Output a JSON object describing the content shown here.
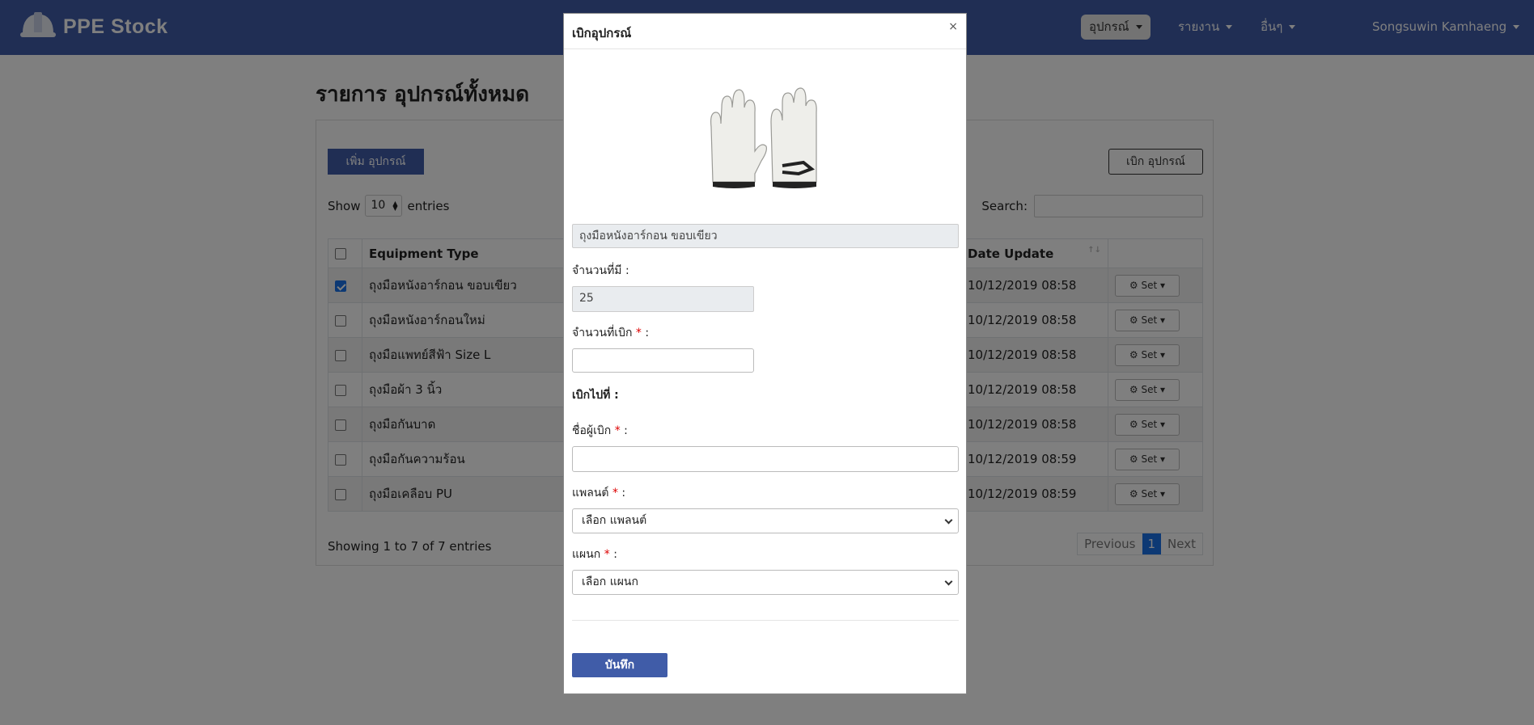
{
  "navbar": {
    "brand": "PPE Stock",
    "menu": [
      {
        "label": "อุปกรณ์",
        "active": true
      },
      {
        "label": "รายงาน",
        "active": false
      },
      {
        "label": "อื่นๆ",
        "active": false
      }
    ],
    "user": "Songsuwin Kamhaeng"
  },
  "page": {
    "title": "รายการ อุปกรณ์ทั้งหมด",
    "add_button": "เพิ่ม อุปกรณ์",
    "withdraw_button": "เบิก อุปกรณ์",
    "show_label": "Show",
    "page_length": "10",
    "entries_label": "entries",
    "search_label": "Search:",
    "table": {
      "columns": [
        "Equipment Type",
        "Date Update"
      ],
      "rows": [
        {
          "checked": true,
          "type": "ถุงมือหนังอาร์กอน ขอบเขียว",
          "date": "10/12/2019 08:58",
          "action": "Set"
        },
        {
          "checked": false,
          "type": "ถุงมือหนังอาร์กอนใหม่",
          "date": "10/12/2019 08:58",
          "action": "Set"
        },
        {
          "checked": false,
          "type": "ถุงมือแพทย์สีฟ้า Size L",
          "date": "10/12/2019 08:58",
          "action": "Set"
        },
        {
          "checked": false,
          "type": "ถุงมือผ้า 3 นิ้ว",
          "date": "10/12/2019 08:58",
          "action": "Set"
        },
        {
          "checked": false,
          "type": "ถุงมือกันบาด",
          "date": "10/12/2019 08:58",
          "action": "Set"
        },
        {
          "checked": false,
          "type": "ถุงมือกันความร้อน",
          "date": "10/12/2019 08:59",
          "action": "Set"
        },
        {
          "checked": false,
          "type": "ถุงมือเคลือบ PU",
          "date": "10/12/2019 08:59",
          "action": "Set"
        }
      ]
    },
    "info": "Showing 1 to 7 of 7 entries",
    "pager": {
      "previous": "Previous",
      "current": "1",
      "next": "Next"
    }
  },
  "modal": {
    "title": "เบิกอุปกรณ์",
    "close": "×",
    "item_name": "ถุงมือหนังอาร์กอน ขอบเขียว",
    "qty_available_label": "จำนวนที่มี :",
    "qty_available": "25",
    "qty_withdraw_label": "จำนวนที่เบิก",
    "withdraw_to_label": "เบิกไปที่ :",
    "requester_label": "ชื่อผู้เบิก",
    "plant_label": "แพลนต์",
    "plant_placeholder": "เลือก แพลนต์",
    "dept_label": "แผนก",
    "dept_placeholder": "เลือก แผนก",
    "required_mark": "*",
    "colon": ":",
    "save_button": "บันทึก"
  },
  "colors": {
    "navbar": "#405ca8",
    "primary": "#405ca8",
    "accent": "#1a73e8",
    "required": "#dd0000"
  }
}
